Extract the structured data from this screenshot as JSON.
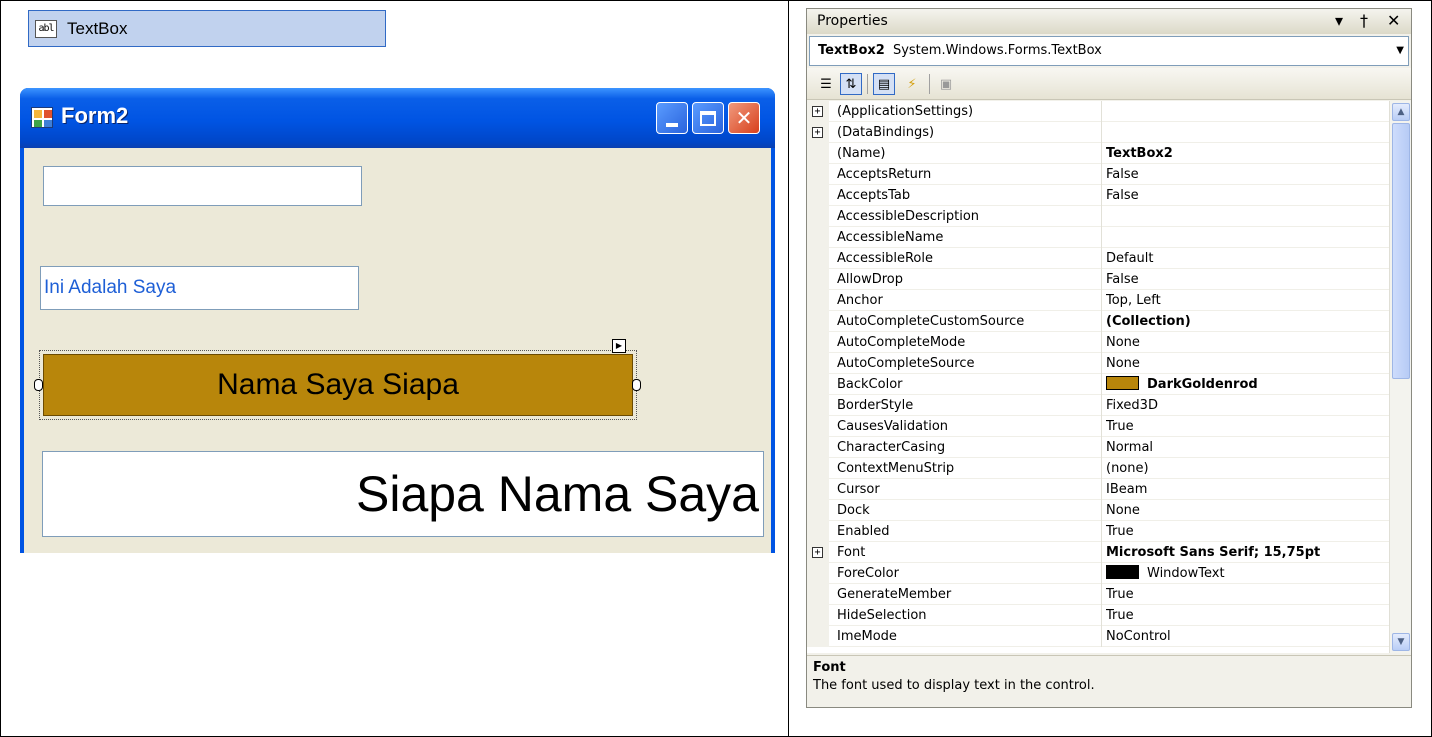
{
  "toolbox": {
    "icon_label": "abl",
    "label": "TextBox"
  },
  "form": {
    "title": "Form2",
    "textbox1_value": "",
    "textbox2_value": "Ini Adalah Saya",
    "textbox3_value": "Nama Saya Siapa",
    "textbox4_value": "Siapa Nama Saya"
  },
  "properties": {
    "title": "Properties",
    "pin_glyph": "▾ † ✕",
    "object_name": "TextBox2",
    "object_type": "System.Windows.Forms.TextBox",
    "rows": [
      {
        "name": "(ApplicationSettings)",
        "value": "",
        "expandable": true,
        "bold": false
      },
      {
        "name": "(DataBindings)",
        "value": "",
        "expandable": true,
        "bold": false
      },
      {
        "name": "(Name)",
        "value": "TextBox2",
        "expandable": false,
        "bold": true
      },
      {
        "name": "AcceptsReturn",
        "value": "False",
        "expandable": false,
        "bold": false
      },
      {
        "name": "AcceptsTab",
        "value": "False",
        "expandable": false,
        "bold": false
      },
      {
        "name": "AccessibleDescription",
        "value": "",
        "expandable": false,
        "bold": false
      },
      {
        "name": "AccessibleName",
        "value": "",
        "expandable": false,
        "bold": false
      },
      {
        "name": "AccessibleRole",
        "value": "Default",
        "expandable": false,
        "bold": false
      },
      {
        "name": "AllowDrop",
        "value": "False",
        "expandable": false,
        "bold": false
      },
      {
        "name": "Anchor",
        "value": "Top, Left",
        "expandable": false,
        "bold": false
      },
      {
        "name": "AutoCompleteCustomSource",
        "value": "(Collection)",
        "expandable": false,
        "bold": true
      },
      {
        "name": "AutoCompleteMode",
        "value": "None",
        "expandable": false,
        "bold": false
      },
      {
        "name": "AutoCompleteSource",
        "value": "None",
        "expandable": false,
        "bold": false
      },
      {
        "name": "BackColor",
        "value": "DarkGoldenrod",
        "expandable": false,
        "bold": true,
        "swatch": "#b8860b"
      },
      {
        "name": "BorderStyle",
        "value": "Fixed3D",
        "expandable": false,
        "bold": false
      },
      {
        "name": "CausesValidation",
        "value": "True",
        "expandable": false,
        "bold": false
      },
      {
        "name": "CharacterCasing",
        "value": "Normal",
        "expandable": false,
        "bold": false
      },
      {
        "name": "ContextMenuStrip",
        "value": "(none)",
        "expandable": false,
        "bold": false
      },
      {
        "name": "Cursor",
        "value": "IBeam",
        "expandable": false,
        "bold": false
      },
      {
        "name": "Dock",
        "value": "None",
        "expandable": false,
        "bold": false
      },
      {
        "name": "Enabled",
        "value": "True",
        "expandable": false,
        "bold": false
      },
      {
        "name": "Font",
        "value": "Microsoft Sans Serif; 15,75pt",
        "expandable": true,
        "bold": true
      },
      {
        "name": "ForeColor",
        "value": "WindowText",
        "expandable": false,
        "bold": false,
        "swatch": "#000000"
      },
      {
        "name": "GenerateMember",
        "value": "True",
        "expandable": false,
        "bold": false
      },
      {
        "name": "HideSelection",
        "value": "True",
        "expandable": false,
        "bold": false
      },
      {
        "name": "ImeMode",
        "value": "NoControl",
        "expandable": false,
        "bold": false
      }
    ],
    "description_title": "Font",
    "description_text": "The font used to display text in the control."
  },
  "colors": {
    "back_color": "#b8860b",
    "xp_titlebar": "#0054e3",
    "form_background": "#ece9d8"
  }
}
